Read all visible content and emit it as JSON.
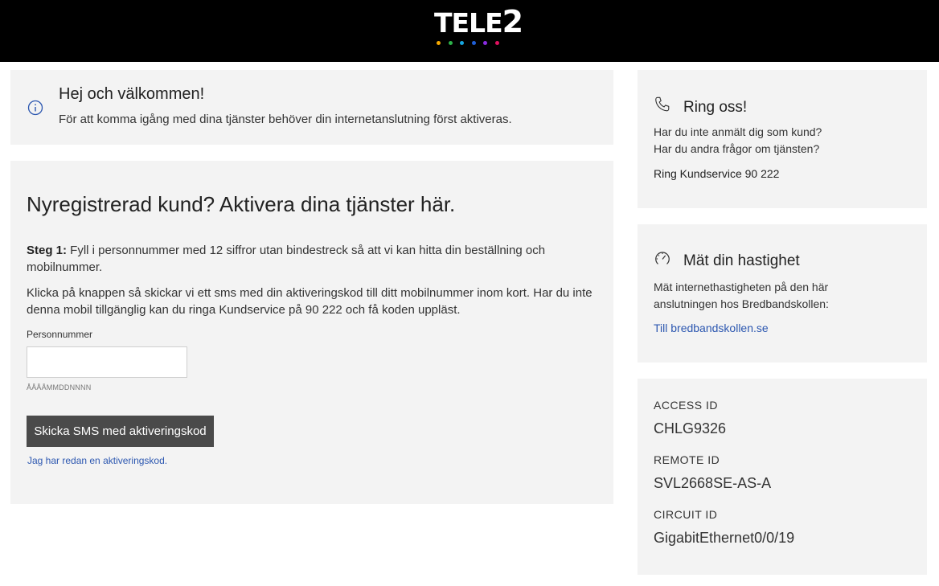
{
  "header": {
    "logo_text": "TELE",
    "logo_digit": "2",
    "dot_colors": [
      "#f5a800",
      "#2db34a",
      "#16a6e0",
      "#1f5fd6",
      "#8a2be2",
      "#e0115f"
    ]
  },
  "welcome": {
    "icon": "info-icon",
    "title": "Hej och välkommen!",
    "text": "För att komma igång med dina tjänster behöver din internetanslutning först aktiveras."
  },
  "register": {
    "title": "Nyregistrerad kund? Aktivera dina tjänster här.",
    "step1_label": "Steg 1:",
    "step1_text": " Fyll i personnummer med 12 siffror utan bindestreck så att vi kan hitta din beställning och mobilnummer.",
    "step2_text": "Klicka på knappen så skickar vi ett sms med din aktiveringskod till ditt mobilnummer inom kort. Har du inte denna mobil tillgänglig kan du ringa Kundservice på 90 222 och få koden uppläst.",
    "field_label": "Personnummer",
    "field_value": "",
    "field_hint": "ÅÅÅÅMMDDNNNN",
    "button_label": "Skicka SMS med aktiveringskod",
    "link_label": "Jag har redan en aktiveringskod."
  },
  "call": {
    "icon": "phone-icon",
    "title": "Ring oss!",
    "line1": "Har du inte anmält dig som kund?",
    "line2": "Har du andra frågor om tjänsten?",
    "phone": "Ring Kundservice 90 222"
  },
  "speed": {
    "icon": "speedometer-icon",
    "title": "Mät din hastighet",
    "text": "Mät internethastigheten på den här anslutningen hos Bredbandskollen:",
    "link": "Till bredbandskollen.se"
  },
  "ids": [
    {
      "label": "ACCESS ID",
      "value": "CHLG9326"
    },
    {
      "label": "REMOTE ID",
      "value": "SVL2668SE-AS-A"
    },
    {
      "label": "CIRCUIT ID",
      "value": "GigabitEthernet0/0/19"
    }
  ],
  "colors": {
    "header_bg": "#000000",
    "panel_bg": "#f3f3f3",
    "button_bg": "#4a4a4a",
    "link": "#2c57b0",
    "info_icon": "#2c57b0"
  }
}
